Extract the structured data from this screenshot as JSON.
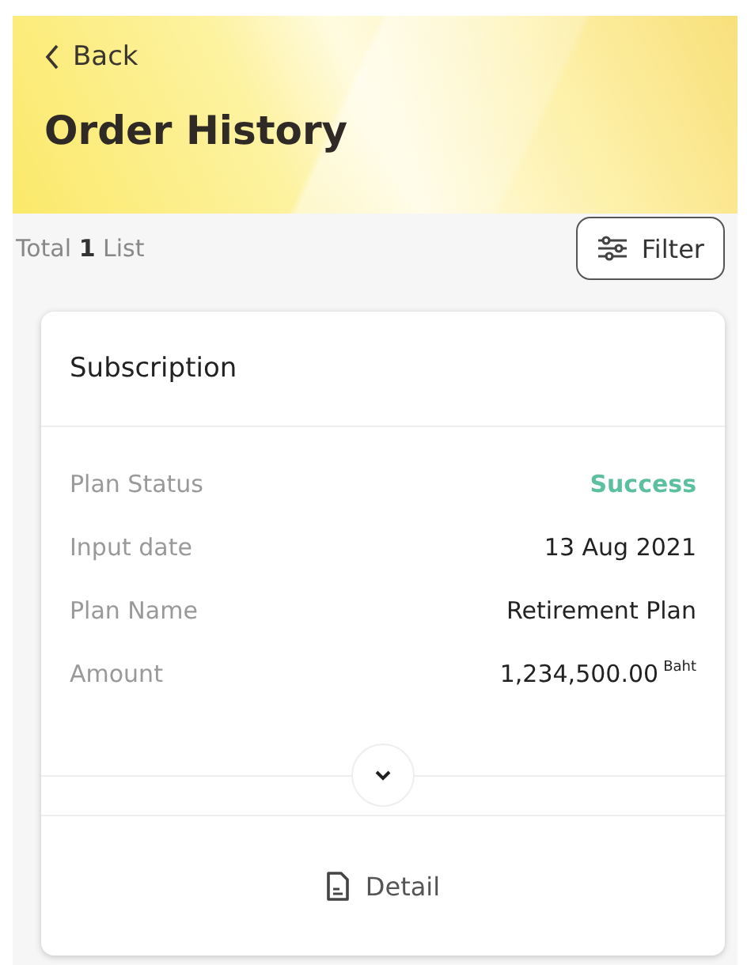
{
  "header": {
    "back": "Back",
    "title": "Order History"
  },
  "summary": {
    "total": "Total **1** List",
    "filter": "Filter"
  },
  "card": {
    "title": "Subscription",
    "rows": [
      {
        "kind": "status",
        "label": "Plan Status",
        "value": "Success"
      },
      {
        "kind": "text",
        "label": "Input date",
        "value": "13 Aug 2021"
      },
      {
        "kind": "text",
        "label": "Plan Name",
        "value": "Retirement Plan"
      },
      {
        "kind": "amount",
        "label": "Amount",
        "value": "1,234,500.00",
        "unit": "Baht"
      }
    ],
    "expanded": false,
    "detail": "Detail"
  }
}
